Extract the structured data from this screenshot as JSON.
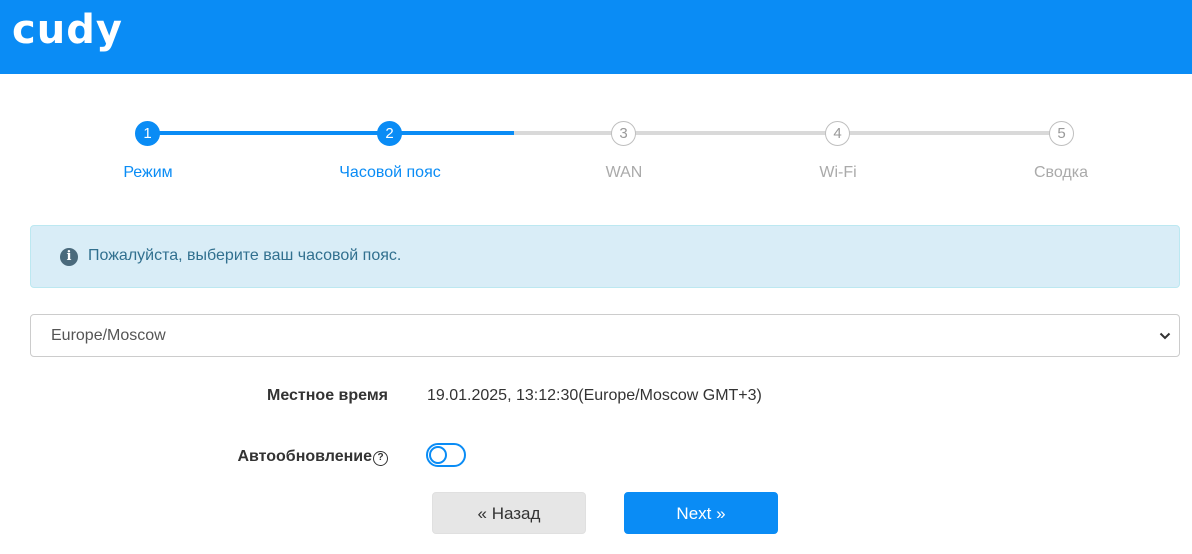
{
  "header": {
    "logo_text": "cudy",
    "background": "#0a8cf5"
  },
  "steps": [
    {
      "number": "1",
      "label": "Режим",
      "state": "active"
    },
    {
      "number": "2",
      "label": "Часовой пояс",
      "state": "active"
    },
    {
      "number": "3",
      "label": "WAN",
      "state": "inactive"
    },
    {
      "number": "4",
      "label": "Wi-Fi",
      "state": "inactive"
    },
    {
      "number": "5",
      "label": "Сводка",
      "state": "inactive"
    }
  ],
  "alert": {
    "icon": "info-icon",
    "text": "Пожалуйста, выберите ваш часовой пояс."
  },
  "timezone_select": {
    "value": "Europe/Moscow"
  },
  "local_time": {
    "label": "Местное время",
    "value": "19.01.2025, 13:12:30(Europe/Moscow GMT+3)"
  },
  "auto_update": {
    "label": "Автообновление",
    "help_icon": "question-circle-icon",
    "toggle_state": "off"
  },
  "buttons": {
    "back_label": "« Назад",
    "next_label": "Next »"
  },
  "colors": {
    "accent": "#0a8cf5",
    "alert_bg": "#d9edf7",
    "alert_text": "#31708f",
    "inactive": "#d9d9d9"
  }
}
